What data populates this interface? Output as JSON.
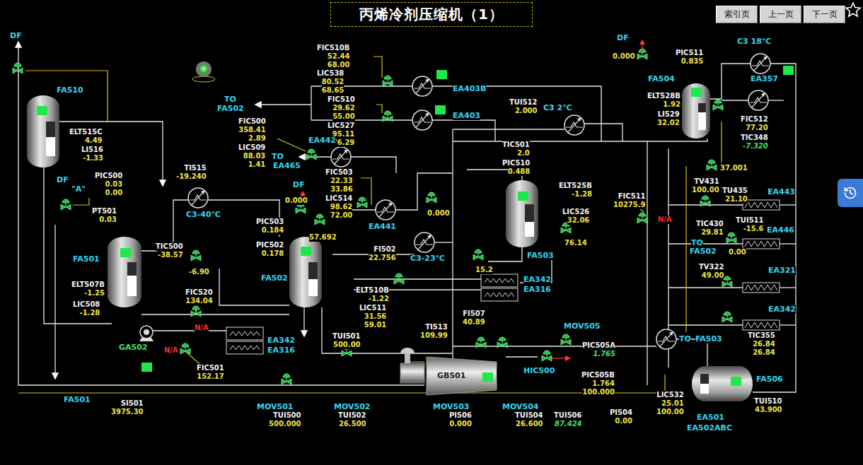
{
  "title": "丙烯冷剂压缩机（1）",
  "nav_buttons": [
    {
      "label": "索引页"
    },
    {
      "label": "上一页"
    },
    {
      "label": "下一页"
    }
  ],
  "status_lamp": {
    "on": true
  },
  "instruments": [
    {
      "tag": "ELT515C",
      "values": [
        {
          "text": "4.49",
          "kind": "value"
        }
      ]
    },
    {
      "tag": "LI516",
      "values": [
        {
          "text": "-1.33",
          "kind": "value"
        }
      ]
    },
    {
      "tag": "PIC500",
      "values": [
        {
          "text": "0.03",
          "kind": "value"
        },
        {
          "text": "0.00",
          "kind": "value"
        }
      ]
    },
    {
      "tag": "PT501",
      "values": [
        {
          "text": "0.03",
          "kind": "value"
        }
      ]
    },
    {
      "tag": "TI515",
      "values": [
        {
          "text": "-19.240",
          "kind": "value"
        }
      ]
    },
    {
      "tag": "TIC500",
      "values": [
        {
          "text": "-38.57",
          "kind": "value"
        }
      ]
    },
    {
      "tag": "ELT507B",
      "values": [
        {
          "text": "-1.25",
          "kind": "value"
        }
      ]
    },
    {
      "tag": "LIC508",
      "values": [
        {
          "text": "-1.28",
          "kind": "value"
        }
      ]
    },
    {
      "tag": "FIC520",
      "values": [
        {
          "text": "134.04",
          "kind": "value"
        }
      ]
    },
    {
      "tag": "FIC501",
      "values": [
        {
          "text": "152.17",
          "kind": "value"
        }
      ]
    },
    {
      "tag": "SI501",
      "values": [
        {
          "text": "3975.30",
          "kind": "value"
        }
      ]
    },
    {
      "tag": "FIC510B",
      "values": [
        {
          "text": "52.44",
          "kind": "value"
        },
        {
          "text": "68.00",
          "kind": "value"
        }
      ]
    },
    {
      "tag": "LIC538",
      "values": [
        {
          "text": "80.52",
          "kind": "value"
        },
        {
          "text": "68.65",
          "kind": "value"
        }
      ]
    },
    {
      "tag": "FIC510",
      "values": [
        {
          "text": "29.62",
          "kind": "value"
        },
        {
          "text": "55.00",
          "kind": "value"
        }
      ]
    },
    {
      "tag": "LIC527",
      "values": [
        {
          "text": "95.11",
          "kind": "value"
        },
        {
          "text": "76.29",
          "kind": "value"
        }
      ]
    },
    {
      "tag": "FIC500",
      "values": [
        {
          "text": "358.41",
          "kind": "value"
        },
        {
          "text": "2.89",
          "kind": "value"
        }
      ]
    },
    {
      "tag": "LIC509",
      "values": [
        {
          "text": "88.03",
          "kind": "value"
        },
        {
          "text": "1.41",
          "kind": "value"
        }
      ]
    },
    {
      "tag": "FIC503",
      "values": [
        {
          "text": "22.33",
          "kind": "value"
        },
        {
          "text": "33.86",
          "kind": "value"
        }
      ]
    },
    {
      "tag": "LIC514",
      "values": [
        {
          "text": "98.62",
          "kind": "value"
        },
        {
          "text": "72.00",
          "kind": "value"
        }
      ]
    },
    {
      "tag": "PIC503",
      "values": [
        {
          "text": "0.184",
          "kind": "value"
        }
      ]
    },
    {
      "tag": "PIC502",
      "values": [
        {
          "text": "0.178",
          "kind": "value"
        }
      ]
    },
    {
      "tag": "FI502",
      "values": [
        {
          "text": "22.756",
          "kind": "value"
        }
      ]
    },
    {
      "tag": "ELT510B",
      "values": [
        {
          "text": "-1.22",
          "kind": "value"
        }
      ]
    },
    {
      "tag": "LIC511",
      "values": [
        {
          "text": "31.56",
          "kind": "value"
        },
        {
          "text": "59.01",
          "kind": "value"
        }
      ]
    },
    {
      "tag": "TUI501",
      "values": [
        {
          "text": "500.00",
          "kind": "value"
        }
      ]
    },
    {
      "tag": "TI513",
      "values": [
        {
          "text": "109.99",
          "kind": "value"
        }
      ]
    },
    {
      "tag": "FI507",
      "values": [
        {
          "text": "40.89",
          "kind": "value"
        }
      ]
    },
    {
      "tag": "TUI512",
      "values": [
        {
          "text": "2.000",
          "kind": "value"
        }
      ]
    },
    {
      "tag": "TIC501",
      "values": [
        {
          "text": "2.0",
          "kind": "value"
        }
      ]
    },
    {
      "tag": "PIC510",
      "values": [
        {
          "text": "0.488",
          "kind": "value"
        }
      ]
    },
    {
      "tag": "ELT525B",
      "values": [
        {
          "text": "-1.28",
          "kind": "value"
        }
      ]
    },
    {
      "tag": "LIC526",
      "values": [
        {
          "text": "32.06",
          "kind": "value"
        }
      ]
    },
    {
      "tag": "FIC511",
      "values": [
        {
          "text": "10275.9",
          "kind": "value"
        }
      ]
    },
    {
      "tag": "TUI500",
      "values": [
        {
          "text": "500.000",
          "kind": "value"
        }
      ]
    },
    {
      "tag": "TUI502",
      "values": [
        {
          "text": "26.500",
          "kind": "value"
        }
      ]
    },
    {
      "tag": "PI506",
      "values": [
        {
          "text": "0.000",
          "kind": "value"
        }
      ]
    },
    {
      "tag": "TUI504",
      "values": [
        {
          "text": "26.600",
          "kind": "value"
        }
      ]
    },
    {
      "tag": "TUI506",
      "values": [
        {
          "text": "87.424",
          "kind": "live"
        }
      ]
    },
    {
      "tag": "PI504",
      "values": [
        {
          "text": "0.00",
          "kind": "value"
        }
      ]
    },
    {
      "tag": "PIC505A",
      "values": [
        {
          "text": "1.765",
          "kind": "live"
        }
      ]
    },
    {
      "tag": "PIC505B",
      "values": [
        {
          "text": "1.764",
          "kind": "value"
        },
        {
          "text": "100.000",
          "kind": "value"
        }
      ]
    },
    {
      "tag": "LIC532",
      "values": [
        {
          "text": "25.01",
          "kind": "value"
        },
        {
          "text": "100.00",
          "kind": "value"
        }
      ]
    },
    {
      "tag": "TUI510",
      "values": [
        {
          "text": "43.900",
          "kind": "value"
        }
      ]
    },
    {
      "tag": "PIC511",
      "values": [
        {
          "text": "0.835",
          "kind": "value"
        }
      ]
    },
    {
      "tag": "ELT528B",
      "values": [
        {
          "text": "1.92",
          "kind": "value"
        }
      ]
    },
    {
      "tag": "LI529",
      "values": [
        {
          "text": "32.02",
          "kind": "value"
        }
      ]
    },
    {
      "tag": "FIC512",
      "values": [
        {
          "text": "77.20",
          "kind": "value"
        }
      ]
    },
    {
      "tag": "TIC348",
      "values": [
        {
          "text": "-7.320",
          "kind": "live"
        }
      ]
    },
    {
      "tag": "TV431",
      "values": [
        {
          "text": "100.00",
          "kind": "value"
        }
      ]
    },
    {
      "tag": "TU435",
      "values": [
        {
          "text": "21.10",
          "kind": "value"
        }
      ]
    },
    {
      "tag": "TUI511",
      "values": [
        {
          "text": "-15.6",
          "kind": "value"
        }
      ]
    },
    {
      "tag": "TIC430",
      "values": [
        {
          "text": "29.81",
          "kind": "value"
        }
      ]
    },
    {
      "tag": "TV322",
      "values": [
        {
          "text": "49.00",
          "kind": "value"
        }
      ]
    },
    {
      "tag": "TIC355",
      "values": [
        {
          "text": "26.84",
          "kind": "value"
        },
        {
          "text": "26.84",
          "kind": "value"
        }
      ]
    }
  ],
  "labels": [
    {
      "text": "DF",
      "kind": "equipment"
    },
    {
      "text": "FA510",
      "kind": "equipment"
    },
    {
      "text": "DF",
      "kind": "equipment"
    },
    {
      "text": "\"A\"",
      "kind": "equipment"
    },
    {
      "text": "C3-40℃",
      "kind": "equipment"
    },
    {
      "text": "FA501",
      "kind": "equipment"
    },
    {
      "text": "-6.90",
      "kind": "value"
    },
    {
      "text": "N/A",
      "kind": "alarm"
    },
    {
      "text": "GA502",
      "kind": "pump"
    },
    {
      "text": "N/A",
      "kind": "alarm"
    },
    {
      "text": "FA501",
      "kind": "equipment"
    },
    {
      "text": "TO",
      "kind": "equipment"
    },
    {
      "text": "FA502",
      "kind": "equipment"
    },
    {
      "text": "TO",
      "kind": "equipment"
    },
    {
      "text": "EA465",
      "kind": "equipment"
    },
    {
      "text": "EA403B",
      "kind": "equipment"
    },
    {
      "text": "EA403",
      "kind": "equipment"
    },
    {
      "text": "EA442",
      "kind": "equipment"
    },
    {
      "text": "DF",
      "kind": "equipment"
    },
    {
      "text": "0.000",
      "kind": "value"
    },
    {
      "text": "57.692",
      "kind": "value"
    },
    {
      "text": "EA441",
      "kind": "equipment"
    },
    {
      "text": "0.000",
      "kind": "value"
    },
    {
      "text": "C3-23℃",
      "kind": "equipment"
    },
    {
      "text": "FA502",
      "kind": "equipment"
    },
    {
      "text": "EA342",
      "kind": "equipment"
    },
    {
      "text": "EA316",
      "kind": "equipment"
    },
    {
      "text": "15.2",
      "kind": "value"
    },
    {
      "text": "EA342",
      "kind": "equipment"
    },
    {
      "text": "EA316",
      "kind": "equipment"
    },
    {
      "text": "GB501",
      "kind": "machine"
    },
    {
      "text": "C3 2℃",
      "kind": "equipment"
    },
    {
      "text": "76.14",
      "kind": "value"
    },
    {
      "text": "FA503",
      "kind": "equipment"
    },
    {
      "text": "N/A",
      "kind": "alarm"
    },
    {
      "text": "MOV501",
      "kind": "equipment"
    },
    {
      "text": "MOV502",
      "kind": "equipment"
    },
    {
      "text": "MOV503",
      "kind": "equipment"
    },
    {
      "text": "MOV504",
      "kind": "equipment"
    },
    {
      "text": "MOV505",
      "kind": "equipment"
    },
    {
      "text": "HIC500",
      "kind": "equipment"
    },
    {
      "text": "EA501",
      "kind": "equipment"
    },
    {
      "text": "EA502ABC",
      "kind": "equipment"
    },
    {
      "text": "FA506",
      "kind": "equipment"
    },
    {
      "text": "TO",
      "kind": "equipment"
    },
    {
      "text": "FA503",
      "kind": "equipment"
    },
    {
      "text": "DF",
      "kind": "equipment"
    },
    {
      "text": "0.000",
      "kind": "value"
    },
    {
      "text": "C3 18℃",
      "kind": "equipment"
    },
    {
      "text": "EA357",
      "kind": "equipment"
    },
    {
      "text": "FA504",
      "kind": "equipment"
    },
    {
      "text": "37.001",
      "kind": "value"
    },
    {
      "text": "EA443",
      "kind": "equipment"
    },
    {
      "text": "EA446",
      "kind": "equipment"
    },
    {
      "text": "TO",
      "kind": "equipment"
    },
    {
      "text": "FA502",
      "kind": "equipment"
    },
    {
      "text": "0.00",
      "kind": "value"
    },
    {
      "text": "EA321",
      "kind": "equipment"
    },
    {
      "text": "EA342",
      "kind": "equipment"
    }
  ],
  "vessels": [
    {
      "level": 0.55
    },
    {
      "level": 0.6
    },
    {
      "level": 0.5
    },
    {
      "level": 0.45
    },
    {
      "level": 0.65
    },
    {
      "level": 0.5
    }
  ],
  "indicators": [
    {
      "on": true
    },
    {
      "on": true
    },
    {
      "on": true
    },
    {
      "on": true
    },
    {
      "on": true
    },
    {
      "on": true
    },
    {
      "on": true
    },
    {
      "on": true
    },
    {
      "on": true
    },
    {
      "on": true
    },
    {
      "on": true
    }
  ]
}
